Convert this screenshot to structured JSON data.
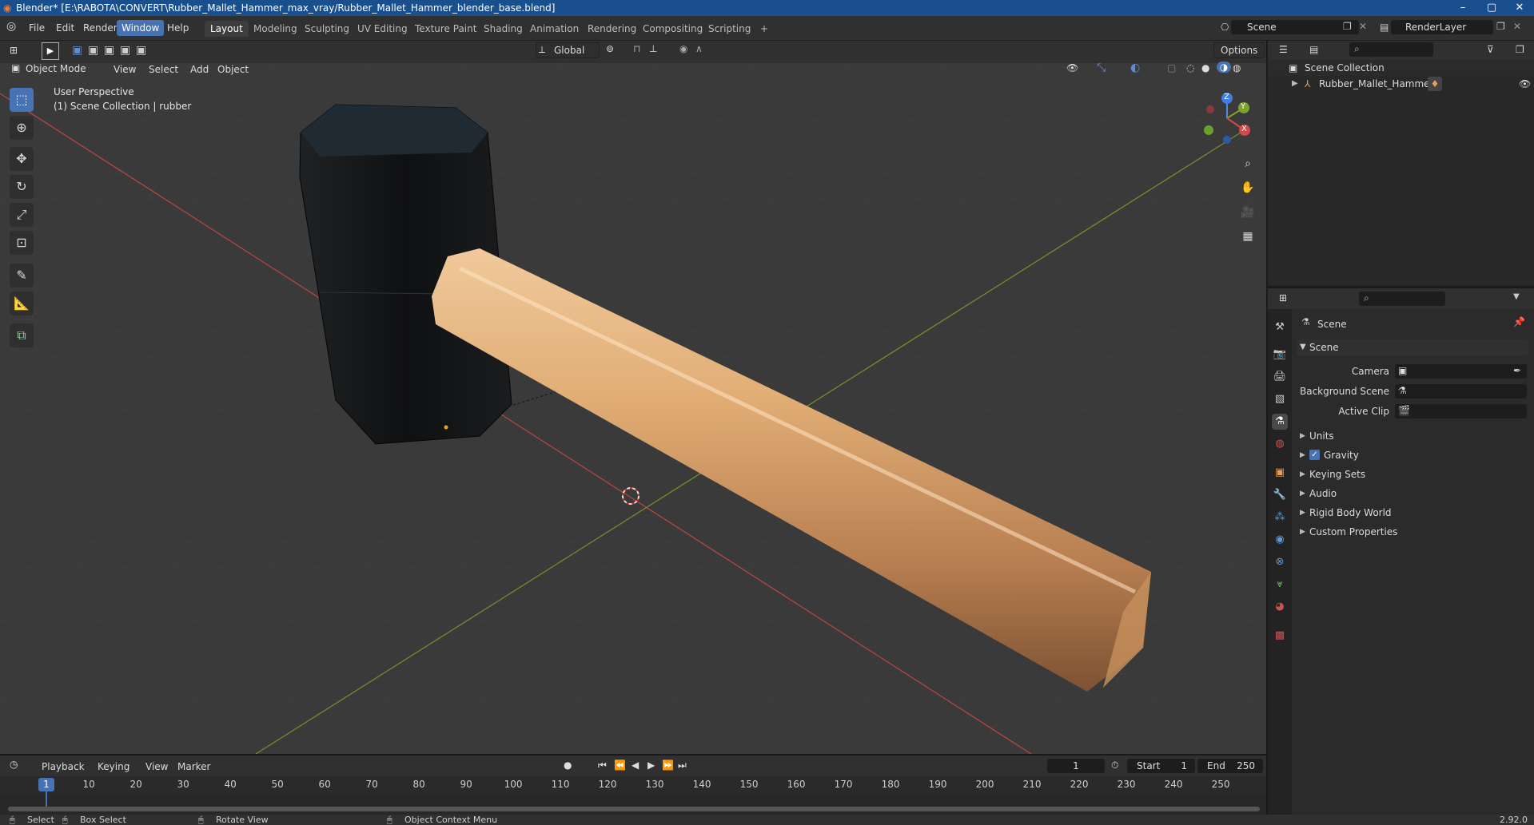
{
  "window": {
    "title": "Blender* [E:\\RABOTA\\CONVERT\\Rubber_Mallet_Hammer_max_vray/Rubber_Mallet_Hammer_blender_base.blend]",
    "minimize": "–",
    "maximize": "▢",
    "close": "✕"
  },
  "menu": [
    "File",
    "Edit",
    "Render",
    "Window",
    "Help"
  ],
  "active_menu": "Window",
  "workspaces": [
    "Layout",
    "Modeling",
    "Sculpting",
    "UV Editing",
    "Texture Paint",
    "Shading",
    "Animation",
    "Rendering",
    "Compositing",
    "Scripting"
  ],
  "add_workspace": "+",
  "scene_field": "Scene",
  "renderlayer_field": "RenderLayer",
  "viewport": {
    "mode": "Object Mode",
    "menus": [
      "View",
      "Select",
      "Add",
      "Object"
    ],
    "transform_orientation": "Global",
    "options": "Options",
    "overlay_line1": "User Perspective",
    "overlay_line2": "(1) Scene Collection | rubber",
    "gizmo": {
      "z": "Z",
      "y": "Y",
      "x": "X"
    },
    "colors": {
      "x_axis": "#d44a4a",
      "y_axis": "#7ea32d",
      "handle": "#d6a56a",
      "head": "#141516"
    }
  },
  "outliner": {
    "root": "Scene Collection",
    "items": [
      {
        "label": "Rubber_Mallet_Hammer"
      }
    ]
  },
  "properties": {
    "context": "Scene",
    "panel": "Scene",
    "fields": [
      {
        "label": "Camera"
      },
      {
        "label": "Background Scene"
      },
      {
        "label": "Active Clip"
      }
    ],
    "subpanels": [
      "Units",
      "Gravity",
      "Keying Sets",
      "Audio",
      "Rigid Body World",
      "Custom Properties"
    ],
    "gravity_checked": true
  },
  "timeline": {
    "menus": [
      "Playback",
      "Keying",
      "View",
      "Marker"
    ],
    "current_frame": "1",
    "start_label": "Start",
    "start": "1",
    "end_label": "End",
    "end": "250",
    "ticks": [
      "1",
      "10",
      "20",
      "30",
      "40",
      "50",
      "60",
      "70",
      "80",
      "90",
      "100",
      "110",
      "120",
      "130",
      "140",
      "150",
      "160",
      "170",
      "180",
      "190",
      "200",
      "210",
      "220",
      "230",
      "240",
      "250"
    ]
  },
  "status": {
    "select": "Select",
    "box_select": "Box Select",
    "rotate_view": "Rotate View",
    "context_menu": "Object Context Menu",
    "version": "2.92.0"
  }
}
